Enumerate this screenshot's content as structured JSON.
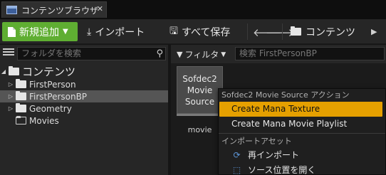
{
  "tab": {
    "title": "コンテンツブラウザ"
  },
  "toolbar": {
    "add_new": "新規追加",
    "import": "インポート",
    "save_all": "すべて保存",
    "breadcrumb": "コンテンツ"
  },
  "sources": {
    "search_placeholder": "フォルダを検索",
    "tree": {
      "root": "コンテンツ",
      "folders": [
        "FirstPerson",
        "FirstPersonBP",
        "Geometry",
        "Movies"
      ]
    }
  },
  "assets": {
    "filter_label": "フィルタ",
    "search_placeholder": "検索 FirstPersonBP",
    "items": [
      {
        "thumbnail_text": "Sofdec2 Movie Source",
        "label": "movie"
      }
    ]
  },
  "context_menu": {
    "section1_header": "Sofdec2 Movie Source アクション",
    "items": [
      "Create Mana Texture",
      "Create Mana Movie Playlist"
    ],
    "section2_header": "インポートアセット",
    "import_items": [
      "再インポート",
      "ソース位置を開く"
    ]
  },
  "colors": {
    "add_button": "#5fae32",
    "menu_highlight": "#e5a000",
    "selection": "#555555"
  }
}
